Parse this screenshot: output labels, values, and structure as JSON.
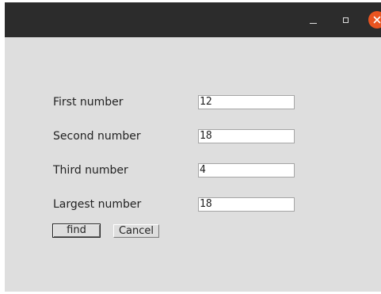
{
  "titlebar": {
    "buttons": {
      "minimize": "minimize-icon",
      "maximize": "maximize-icon",
      "close": "close-icon"
    },
    "colors": {
      "background": "#2c2c2c",
      "close": "#e95420"
    }
  },
  "form": {
    "fields": [
      {
        "label": "First number",
        "value": "12"
      },
      {
        "label": "Second number",
        "value": "18"
      },
      {
        "label": "Third number",
        "value": "4"
      },
      {
        "label": "Largest number",
        "value": "18"
      }
    ],
    "buttons": {
      "find_label": "find",
      "cancel_label": "Cancel"
    }
  }
}
